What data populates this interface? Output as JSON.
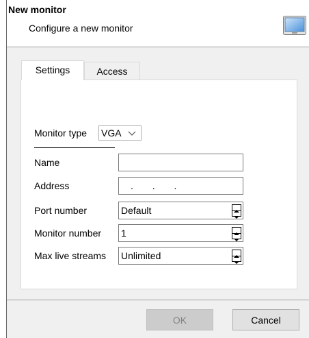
{
  "header": {
    "title": "New monitor",
    "subtitle": "Configure a new monitor",
    "icon": "monitor-icon"
  },
  "tabs": [
    {
      "label": "Settings",
      "active": true
    },
    {
      "label": "Access",
      "active": false
    }
  ],
  "settings": {
    "monitor_type": {
      "label": "Monitor type",
      "value": "VGA"
    },
    "name": {
      "label": "Name",
      "value": ""
    },
    "address": {
      "label": "Address",
      "value": ". . ."
    },
    "port_number": {
      "label": "Port number",
      "value": "Default"
    },
    "monitor_number": {
      "label": "Monitor number",
      "value": "1"
    },
    "max_live_streams": {
      "label": "Max live streams",
      "value": "Unlimited"
    }
  },
  "buttons": {
    "ok": {
      "label": "OK",
      "enabled": false
    },
    "cancel": {
      "label": "Cancel",
      "enabled": true
    }
  }
}
